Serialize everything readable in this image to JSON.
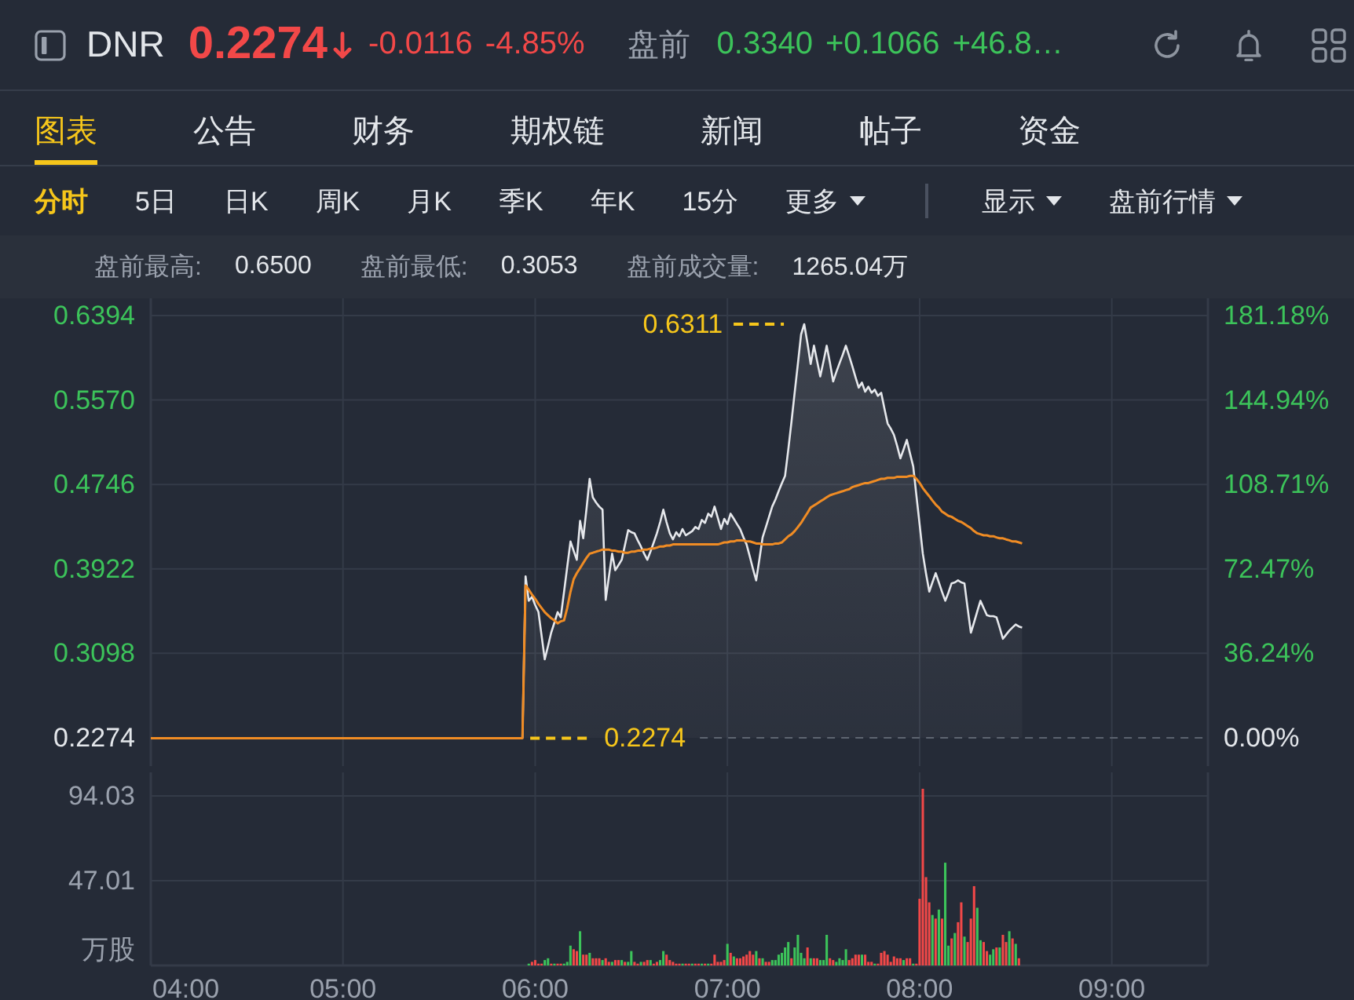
{
  "header": {
    "symbol": "DNR",
    "quote": {
      "price": "0.2274",
      "falling": true,
      "change": "-0.0116",
      "change_percent": "-4.85%"
    },
    "premarket": {
      "label": "盘前",
      "price": "0.3340",
      "change": "+0.1066",
      "change_percent": "+46.8…",
      "falling": false
    }
  },
  "tabs": [
    {
      "label": "图表",
      "selected": true
    },
    {
      "label": "公告",
      "selected": false
    },
    {
      "label": "财务",
      "selected": false
    },
    {
      "label": "期权链",
      "selected": false
    },
    {
      "label": "新闻",
      "selected": false
    },
    {
      "label": "帖子",
      "selected": false
    },
    {
      "label": "资金",
      "selected": false
    }
  ],
  "periods": [
    {
      "label": "分时",
      "selected": true,
      "kind": "option"
    },
    {
      "label": "5日",
      "selected": false,
      "kind": "option"
    },
    {
      "label": "日K",
      "selected": false,
      "kind": "option"
    },
    {
      "label": "周K",
      "selected": false,
      "kind": "option"
    },
    {
      "label": "月K",
      "selected": false,
      "kind": "option"
    },
    {
      "label": "季K",
      "selected": false,
      "kind": "option"
    },
    {
      "label": "年K",
      "selected": false,
      "kind": "option"
    },
    {
      "label": "15分",
      "selected": false,
      "kind": "option"
    },
    {
      "label": "更多",
      "selected": false,
      "kind": "dropdown"
    }
  ],
  "view_menus": [
    {
      "label": "显示"
    },
    {
      "label": "盘前行情"
    }
  ],
  "stats": [
    {
      "label": "盘前最高:",
      "value": "0.6500"
    },
    {
      "label": "盘前最低:",
      "value": "0.3053"
    },
    {
      "label": "盘前成交量:",
      "value": "1265.04万"
    }
  ],
  "price_chart": {
    "right_axis_labels": [
      "181.18%",
      "144.94%",
      "108.71%",
      "72.47%",
      "36.24%",
      "0.00%"
    ],
    "markers": [
      {
        "kind": "max",
        "text": "0.6311"
      },
      {
        "kind": "min",
        "text": "0.2274"
      }
    ],
    "chart_data": {
      "type": "area",
      "grid": true,
      "categories": [
        null,
        null,
        null,
        null,
        null,
        null,
        null,
        null,
        null,
        null,
        null,
        null,
        null,
        null,
        null,
        null,
        null,
        null,
        null,
        null,
        null,
        null,
        null,
        null,
        null,
        null,
        null,
        null,
        null,
        null,
        null,
        null,
        null,
        null,
        null,
        null,
        null,
        null,
        null,
        null,
        null,
        null,
        null,
        null,
        null,
        null,
        null,
        null,
        null,
        null,
        null,
        null,
        null,
        null,
        null,
        null,
        null,
        null,
        null,
        null,
        null,
        null,
        null,
        null,
        null,
        null,
        null,
        null,
        null,
        null,
        null,
        null,
        null,
        null,
        null,
        null,
        null,
        null,
        null,
        null,
        null,
        null,
        null,
        null,
        null,
        null,
        null,
        null,
        null,
        null,
        null,
        null,
        null,
        null,
        null,
        null,
        null,
        null,
        null,
        null,
        null,
        null,
        null,
        null,
        null,
        null,
        null,
        null,
        null,
        null,
        null,
        null,
        null,
        null,
        null,
        null,
        null,
        null,
        null,
        null,
        null,
        null,
        null,
        null,
        null,
        null,
        null,
        null,
        null,
        null,
        null,
        null,
        null,
        null,
        null,
        null,
        null,
        null,
        null,
        null,
        null,
        null,
        null,
        null,
        null,
        null,
        null,
        null,
        null,
        null,
        null,
        null,
        null,
        null,
        null,
        null,
        null,
        null,
        null,
        null,
        null,
        null,
        null,
        null,
        null,
        null,
        null,
        null,
        null,
        null,
        null,
        null,
        null,
        null,
        null,
        null,
        null,
        null,
        null,
        null,
        null,
        null,
        null,
        null,
        null,
        null,
        null,
        null,
        null,
        null,
        null,
        null,
        null,
        null,
        null,
        null,
        null,
        null,
        null,
        null,
        null,
        null,
        null,
        null,
        null,
        null,
        null,
        null,
        null,
        null,
        null,
        null,
        null,
        null,
        null,
        null,
        null,
        null,
        null,
        null,
        null,
        null,
        null,
        null,
        null,
        null,
        null,
        null,
        null,
        null,
        null,
        null,
        null,
        null,
        null,
        null,
        null,
        null,
        null,
        null,
        null,
        null,
        null,
        null,
        null,
        null,
        null,
        null,
        null,
        null,
        null,
        null,
        null,
        null,
        null,
        null,
        null,
        null,
        null,
        null,
        null,
        null,
        null,
        null,
        null,
        null,
        null,
        null,
        null,
        null,
        null,
        null,
        null,
        null,
        null,
        null,
        null,
        null,
        null,
        null,
        null,
        null,
        null,
        null,
        null,
        null,
        null,
        null,
        null,
        null,
        null,
        null,
        null,
        null,
        null,
        null,
        null,
        null,
        null,
        null,
        null,
        null,
        null,
        null,
        null,
        null,
        null,
        null,
        null,
        null,
        null,
        null,
        null,
        null,
        null,
        null,
        null,
        null,
        null,
        null,
        null,
        null,
        null,
        null,
        null,
        null,
        null,
        null,
        null,
        null,
        null
      ],
      "series": [
        {
          "color": "#e6e8ec",
          "values": [
            null,
            null,
            null,
            null,
            null,
            null,
            null,
            null,
            null,
            null,
            null,
            null,
            null,
            null,
            null,
            null,
            null,
            null,
            null,
            null,
            null,
            null,
            null,
            null,
            null,
            null,
            null,
            null,
            null,
            null,
            null,
            null,
            null,
            null,
            null,
            null,
            null,
            null,
            null,
            null,
            null,
            null,
            null,
            null,
            null,
            null,
            null,
            null,
            null,
            null,
            null,
            null,
            null,
            null,
            null,
            null,
            null,
            null,
            null,
            null,
            null,
            null,
            null,
            null,
            null,
            null,
            null,
            null,
            null,
            null,
            null,
            null,
            null,
            null,
            null,
            null,
            null,
            null,
            null,
            null,
            null,
            null,
            null,
            null,
            null,
            null,
            null,
            null,
            null,
            null,
            null,
            null,
            null,
            null,
            null,
            null,
            null,
            null,
            null,
            null,
            null,
            null,
            null,
            null,
            null,
            null,
            null,
            null,
            null,
            null,
            null,
            null,
            null,
            null,
            null,
            null,
            0.227,
            0.385,
            0.361,
            0.365,
            0.357,
            0.35,
            0.327,
            0.304,
            0.317,
            0.33,
            0.34,
            0.35,
            0.345,
            0.37,
            0.394,
            0.419,
            0.41,
            0.401,
            0.439,
            0.422,
            0.451,
            0.48,
            0.462,
            0.457,
            0.453,
            0.45,
            0.362,
            0.384,
            0.407,
            0.391,
            0.396,
            0.401,
            0.415,
            0.43,
            0.428,
            0.427,
            0.42,
            0.414,
            0.407,
            0.401,
            0.409,
            0.418,
            0.427,
            0.438,
            0.45,
            0.438,
            0.427,
            0.421,
            0.428,
            0.424,
            0.431,
            0.425,
            0.427,
            0.429,
            0.433,
            0.431,
            0.44,
            0.437,
            0.446,
            0.443,
            0.453,
            0.442,
            0.431,
            0.441,
            0.436,
            0.446,
            0.441,
            0.436,
            0.431,
            0.423,
            0.416,
            0.404,
            0.392,
            0.381,
            0.402,
            0.423,
            0.433,
            0.443,
            0.453,
            0.46,
            0.468,
            0.476,
            0.483,
            0.508,
            0.536,
            0.564,
            0.593,
            0.621,
            0.631,
            0.612,
            0.592,
            0.61,
            0.595,
            0.58,
            0.595,
            0.61,
            0.593,
            0.575,
            0.584,
            0.593,
            0.601,
            0.61,
            0.6,
            0.59,
            0.579,
            0.569,
            0.574,
            0.565,
            0.57,
            0.564,
            0.567,
            0.561,
            0.564,
            0.549,
            0.534,
            0.529,
            0.523,
            0.512,
            0.5,
            0.509,
            0.518,
            0.505,
            0.492,
            0.464,
            0.435,
            0.407,
            0.388,
            0.37,
            0.379,
            0.388,
            0.379,
            0.37,
            0.361,
            0.369,
            0.378,
            0.379,
            0.381,
            0.379,
            0.378,
            0.354,
            0.33,
            0.34,
            0.351,
            0.361,
            0.354,
            0.347,
            0.346,
            0.346,
            0.345,
            0.335,
            0.324,
            0.328,
            0.332,
            0.335,
            0.338,
            0.336,
            0.335,
            null,
            null,
            null,
            null,
            null,
            null,
            null,
            null,
            null,
            null,
            null,
            null,
            null,
            null,
            null,
            null,
            null,
            null,
            null,
            null,
            null,
            null,
            null,
            null,
            null,
            null,
            null,
            null,
            null,
            null,
            null,
            null,
            null,
            null,
            null,
            null,
            null,
            null,
            null,
            null,
            null,
            null,
            null,
            null,
            null,
            null,
            null,
            null,
            null,
            null,
            null,
            null,
            null,
            null,
            null,
            null,
            null,
            null
          ]
        },
        {
          "type": "line",
          "color": "#f08c24",
          "values": [
            0.227,
            0.227,
            0.227,
            0.227,
            0.227,
            0.227,
            0.227,
            0.227,
            0.227,
            0.227,
            0.227,
            0.227,
            0.227,
            0.227,
            0.227,
            0.227,
            0.227,
            0.227,
            0.227,
            0.227,
            0.227,
            0.227,
            0.227,
            0.227,
            0.227,
            0.227,
            0.227,
            0.227,
            0.227,
            0.227,
            0.227,
            0.227,
            0.227,
            0.227,
            0.227,
            0.227,
            0.227,
            0.227,
            0.227,
            0.227,
            0.227,
            0.227,
            0.227,
            0.227,
            0.227,
            0.227,
            0.227,
            0.227,
            0.227,
            0.227,
            0.227,
            0.227,
            0.227,
            0.227,
            0.227,
            0.227,
            0.227,
            0.227,
            0.227,
            0.227,
            0.227,
            0.227,
            0.227,
            0.227,
            0.227,
            0.227,
            0.227,
            0.227,
            0.227,
            0.227,
            0.227,
            0.227,
            0.227,
            0.227,
            0.227,
            0.227,
            0.227,
            0.227,
            0.227,
            0.227,
            0.227,
            0.227,
            0.227,
            0.227,
            0.227,
            0.227,
            0.227,
            0.227,
            0.227,
            0.227,
            0.227,
            0.227,
            0.227,
            0.227,
            0.227,
            0.227,
            0.227,
            0.227,
            0.227,
            0.227,
            0.227,
            0.227,
            0.227,
            0.227,
            0.227,
            0.227,
            0.227,
            0.227,
            0.227,
            0.227,
            0.227,
            0.227,
            0.227,
            0.227,
            0.227,
            0.227,
            0.227,
            0.376,
            0.372,
            0.367,
            0.363,
            0.358,
            0.354,
            0.35,
            0.347,
            0.344,
            0.342,
            0.339,
            0.341,
            0.342,
            0.354,
            0.37,
            0.382,
            0.388,
            0.393,
            0.398,
            0.403,
            0.407,
            0.408,
            0.409,
            0.41,
            0.411,
            0.411,
            0.411,
            0.41,
            0.41,
            0.409,
            0.409,
            0.408,
            0.408,
            0.409,
            0.409,
            0.41,
            0.41,
            0.411,
            0.411,
            0.412,
            0.412,
            0.413,
            0.414,
            0.414,
            0.415,
            0.415,
            0.416,
            0.416,
            0.416,
            0.416,
            0.416,
            0.416,
            0.416,
            0.416,
            0.416,
            0.416,
            0.416,
            0.416,
            0.416,
            0.416,
            0.416,
            0.417,
            0.418,
            0.418,
            0.419,
            0.419,
            0.42,
            0.42,
            0.42,
            0.419,
            0.419,
            0.418,
            0.417,
            0.417,
            0.416,
            0.416,
            0.416,
            0.416,
            0.417,
            0.417,
            0.418,
            0.421,
            0.424,
            0.426,
            0.429,
            0.433,
            0.437,
            0.442,
            0.447,
            0.452,
            0.454,
            0.456,
            0.458,
            0.46,
            0.462,
            0.464,
            0.465,
            0.466,
            0.467,
            0.468,
            0.469,
            0.47,
            0.472,
            0.473,
            0.474,
            0.475,
            0.476,
            0.476,
            0.477,
            0.478,
            0.479,
            0.48,
            0.48,
            0.481,
            0.481,
            0.481,
            0.482,
            0.482,
            0.482,
            0.482,
            0.483,
            0.483,
            0.48,
            0.476,
            0.471,
            0.467,
            0.463,
            0.459,
            0.455,
            0.452,
            0.448,
            0.446,
            0.444,
            0.443,
            0.441,
            0.439,
            0.438,
            0.436,
            0.434,
            0.432,
            0.429,
            0.427,
            0.426,
            0.425,
            0.425,
            0.424,
            0.424,
            0.423,
            0.422,
            0.422,
            0.421,
            0.42,
            0.419,
            0.419,
            0.418,
            0.417,
            null,
            null,
            null,
            null,
            null,
            null,
            null,
            null,
            null,
            null,
            null,
            null,
            null,
            null,
            null,
            null,
            null,
            null,
            null,
            null,
            null,
            null,
            null,
            null,
            null,
            null,
            null,
            null,
            null,
            null,
            null,
            null,
            null,
            null,
            null,
            null,
            null,
            null,
            null,
            null,
            null,
            null,
            null,
            null,
            null,
            null,
            null,
            null,
            null,
            null,
            null,
            null,
            null,
            null,
            null,
            null,
            null,
            null
          ]
        }
      ],
      "ylim": [
        0.1998,
        0.6562
      ],
      "yticks": [
        {
          "value": 0.2274,
          "label": "0.2274"
        },
        {
          "value": 0.3098,
          "label": "0.3098"
        },
        {
          "value": 0.3922,
          "label": "0.3922"
        },
        {
          "value": 0.4746,
          "label": "0.4746"
        },
        {
          "value": 0.557,
          "label": "0.5570"
        },
        {
          "value": 0.6394,
          "label": "0.6394"
        }
      ]
    }
  },
  "volume_chart": {
    "chart_data": {
      "type": "bar",
      "ylabel": "万股",
      "stacked": true,
      "grid": true,
      "ylim": [
        0,
        107.1
      ],
      "categories": [
        "04:00",
        null,
        null,
        null,
        null,
        null,
        null,
        null,
        null,
        null,
        null,
        null,
        null,
        null,
        null,
        null,
        null,
        null,
        null,
        null,
        null,
        null,
        null,
        null,
        null,
        null,
        null,
        null,
        null,
        null,
        null,
        null,
        null,
        null,
        null,
        null,
        null,
        null,
        null,
        null,
        null,
        null,
        null,
        null,
        null,
        null,
        null,
        null,
        null,
        null,
        null,
        null,
        null,
        null,
        null,
        null,
        null,
        null,
        null,
        null,
        "05:00",
        null,
        null,
        null,
        null,
        null,
        null,
        null,
        null,
        null,
        null,
        null,
        null,
        null,
        null,
        null,
        null,
        null,
        null,
        null,
        null,
        null,
        null,
        null,
        null,
        null,
        null,
        null,
        null,
        null,
        null,
        null,
        null,
        null,
        null,
        null,
        null,
        null,
        null,
        null,
        null,
        null,
        null,
        null,
        null,
        null,
        null,
        null,
        null,
        null,
        null,
        null,
        null,
        null,
        null,
        null,
        null,
        null,
        null,
        null,
        "06:00",
        null,
        null,
        null,
        null,
        null,
        null,
        null,
        null,
        null,
        null,
        null,
        null,
        null,
        null,
        null,
        null,
        null,
        null,
        null,
        null,
        null,
        null,
        null,
        null,
        null,
        null,
        null,
        null,
        null,
        null,
        null,
        null,
        null,
        null,
        null,
        null,
        null,
        null,
        null,
        null,
        null,
        null,
        null,
        null,
        null,
        null,
        null,
        null,
        null,
        null,
        null,
        null,
        null,
        null,
        null,
        null,
        null,
        null,
        null,
        "07:00",
        null,
        null,
        null,
        null,
        null,
        null,
        null,
        null,
        null,
        null,
        null,
        null,
        null,
        null,
        null,
        null,
        null,
        null,
        null,
        null,
        null,
        null,
        null,
        null,
        null,
        null,
        null,
        null,
        null,
        null,
        null,
        null,
        null,
        null,
        null,
        null,
        null,
        null,
        null,
        null,
        null,
        null,
        null,
        null,
        null,
        null,
        null,
        null,
        null,
        null,
        null,
        null,
        null,
        null,
        null,
        null,
        null,
        null,
        null,
        "08:00",
        null,
        null,
        null,
        null,
        null,
        null,
        null,
        null,
        null,
        null,
        null,
        null,
        null,
        null,
        null,
        null,
        null,
        null,
        null,
        null,
        null,
        null,
        null,
        null,
        null,
        null,
        null,
        null,
        null,
        null,
        null,
        null,
        null,
        null,
        null,
        null,
        null,
        null,
        null,
        null,
        null,
        null,
        null,
        null,
        null,
        null,
        null,
        null,
        null,
        null,
        null,
        null,
        null,
        null,
        null,
        null,
        null,
        null,
        null,
        "09:00",
        null,
        null,
        null,
        null,
        null,
        null,
        null,
        null,
        null,
        null,
        null,
        null,
        null,
        null,
        null,
        null,
        null,
        null,
        null,
        null,
        null,
        null,
        null,
        null,
        null,
        null,
        null,
        null,
        null,
        null
      ],
      "series": [
        {
          "color": "#3cc35a",
          "values": [
            null,
            null,
            null,
            null,
            null,
            null,
            null,
            null,
            null,
            null,
            null,
            null,
            null,
            null,
            null,
            null,
            null,
            null,
            null,
            null,
            null,
            null,
            null,
            null,
            null,
            null,
            null,
            null,
            null,
            null,
            null,
            null,
            null,
            null,
            null,
            null,
            null,
            null,
            null,
            null,
            null,
            null,
            null,
            null,
            null,
            null,
            null,
            null,
            null,
            null,
            null,
            null,
            null,
            null,
            null,
            null,
            null,
            null,
            null,
            null,
            null,
            null,
            null,
            null,
            null,
            null,
            null,
            null,
            null,
            null,
            null,
            null,
            null,
            null,
            null,
            null,
            null,
            null,
            null,
            null,
            null,
            null,
            null,
            null,
            null,
            null,
            null,
            null,
            null,
            null,
            null,
            null,
            null,
            null,
            null,
            null,
            null,
            null,
            null,
            null,
            null,
            null,
            null,
            null,
            null,
            null,
            null,
            null,
            null,
            null,
            null,
            null,
            null,
            null,
            null,
            null,
            null,
            null,
            1,
            null,
            null,
            null,
            null,
            3,
            4,
            null,
            1,
            null,
            null,
            1,
            2,
            11,
            null,
            null,
            19,
            null,
            null,
            7,
            null,
            null,
            null,
            3,
            null,
            null,
            2,
            null,
            null,
            3,
            null,
            2,
            8,
            null,
            null,
            2,
            null,
            null,
            3,
            null,
            null,
            3,
            8,
            null,
            null,
            null,
            null,
            null,
            1,
            null,
            null,
            1,
            null,
            null,
            1,
            null,
            1,
            null,
            null,
            null,
            null,
            null,
            12,
            null,
            5,
            null,
            null,
            null,
            null,
            null,
            null,
            8,
            null,
            4,
            null,
            null,
            3,
            3,
            6,
            7,
            10,
            13,
            null,
            10,
            17,
            7,
            4,
            null,
            4,
            null,
            null,
            3,
            3,
            17,
            null,
            null,
            2,
            4,
            3,
            9,
            null,
            null,
            null,
            null,
            6,
            null,
            null,
            null,
            1,
            null,
            null,
            null,
            null,
            null,
            null,
            null,
            null,
            3,
            null,
            null,
            1,
            null,
            null,
            null,
            null,
            null,
            28,
            null,
            31,
            null,
            57,
            11,
            null,
            18,
            null,
            null,
            16,
            null,
            null,
            null,
            32,
            14,
            null,
            null,
            6,
            9,
            null,
            10,
            null,
            null,
            19,
            null,
            12,
            null,
            null,
            null,
            null,
            null,
            null,
            null,
            null,
            null,
            null,
            null,
            null,
            null,
            null,
            null,
            null,
            null,
            null,
            null,
            null,
            null,
            null,
            null,
            null,
            null,
            null,
            null,
            null,
            null,
            null,
            null,
            null,
            null,
            null,
            null,
            null,
            null,
            null,
            null,
            null,
            null,
            null,
            null,
            null,
            null,
            null,
            null,
            null,
            null,
            null,
            null,
            null,
            null,
            null,
            null,
            null,
            null,
            null,
            null,
            null
          ]
        },
        {
          "color": "#f24848",
          "values": [
            null,
            null,
            null,
            null,
            null,
            null,
            null,
            null,
            null,
            null,
            null,
            null,
            null,
            null,
            null,
            null,
            null,
            null,
            null,
            null,
            null,
            null,
            null,
            null,
            null,
            null,
            null,
            null,
            null,
            null,
            null,
            null,
            null,
            null,
            null,
            null,
            null,
            null,
            null,
            null,
            null,
            null,
            null,
            null,
            null,
            null,
            null,
            null,
            null,
            null,
            null,
            null,
            null,
            null,
            null,
            null,
            null,
            null,
            null,
            null,
            null,
            null,
            null,
            null,
            null,
            null,
            null,
            null,
            null,
            null,
            null,
            null,
            null,
            null,
            null,
            null,
            null,
            null,
            null,
            null,
            null,
            null,
            null,
            null,
            null,
            null,
            null,
            null,
            null,
            null,
            null,
            null,
            null,
            null,
            null,
            null,
            null,
            null,
            null,
            null,
            null,
            null,
            null,
            null,
            null,
            null,
            null,
            null,
            null,
            null,
            null,
            null,
            null,
            null,
            null,
            null,
            null,
            null,
            null,
            2,
            3,
            1,
            1,
            null,
            null,
            1,
            null,
            1,
            1,
            null,
            null,
            null,
            9,
            8,
            null,
            6,
            6,
            null,
            4,
            4,
            4,
            null,
            4,
            2,
            null,
            3,
            3,
            null,
            2,
            null,
            null,
            2,
            1,
            null,
            2,
            3,
            null,
            1,
            2,
            null,
            null,
            6,
            3,
            2,
            1,
            1,
            null,
            1,
            1,
            null,
            1,
            1,
            null,
            1,
            null,
            1,
            6,
            2,
            2,
            3,
            null,
            7,
            null,
            4,
            4,
            5,
            6,
            8,
            6,
            null,
            4,
            null,
            2,
            2,
            null,
            null,
            null,
            null,
            null,
            null,
            4,
            null,
            null,
            null,
            null,
            10,
            null,
            4,
            4,
            null,
            null,
            null,
            4,
            3,
            null,
            null,
            null,
            null,
            3,
            4,
            6,
            6,
            null,
            6,
            2,
            2,
            null,
            1,
            7,
            8,
            6,
            2,
            5,
            4,
            4,
            null,
            4,
            4,
            null,
            1,
            37,
            98,
            49,
            35,
            null,
            26,
            null,
            26,
            null,
            null,
            15,
            null,
            24,
            35,
            null,
            13,
            26,
            44,
            null,
            null,
            13,
            8,
            null,
            null,
            10,
            null,
            17,
            13,
            null,
            15,
            null,
            4,
            null,
            null,
            null,
            null,
            null,
            null,
            null,
            null,
            null,
            null,
            null,
            null,
            null,
            null,
            null,
            null,
            null,
            null,
            null,
            null,
            null,
            null,
            null,
            null,
            null,
            null,
            null,
            null,
            null,
            null,
            null,
            null,
            null,
            null,
            null,
            null,
            null,
            null,
            null,
            null,
            null,
            null,
            null,
            null,
            null,
            null,
            null,
            null,
            null,
            null,
            null,
            null,
            null,
            null,
            null,
            null,
            null,
            null,
            null
          ]
        }
      ],
      "yticks": [
        {
          "value": 47.01,
          "label": "47.01"
        },
        {
          "value": 94.03,
          "label": "94.03"
        }
      ]
    }
  }
}
